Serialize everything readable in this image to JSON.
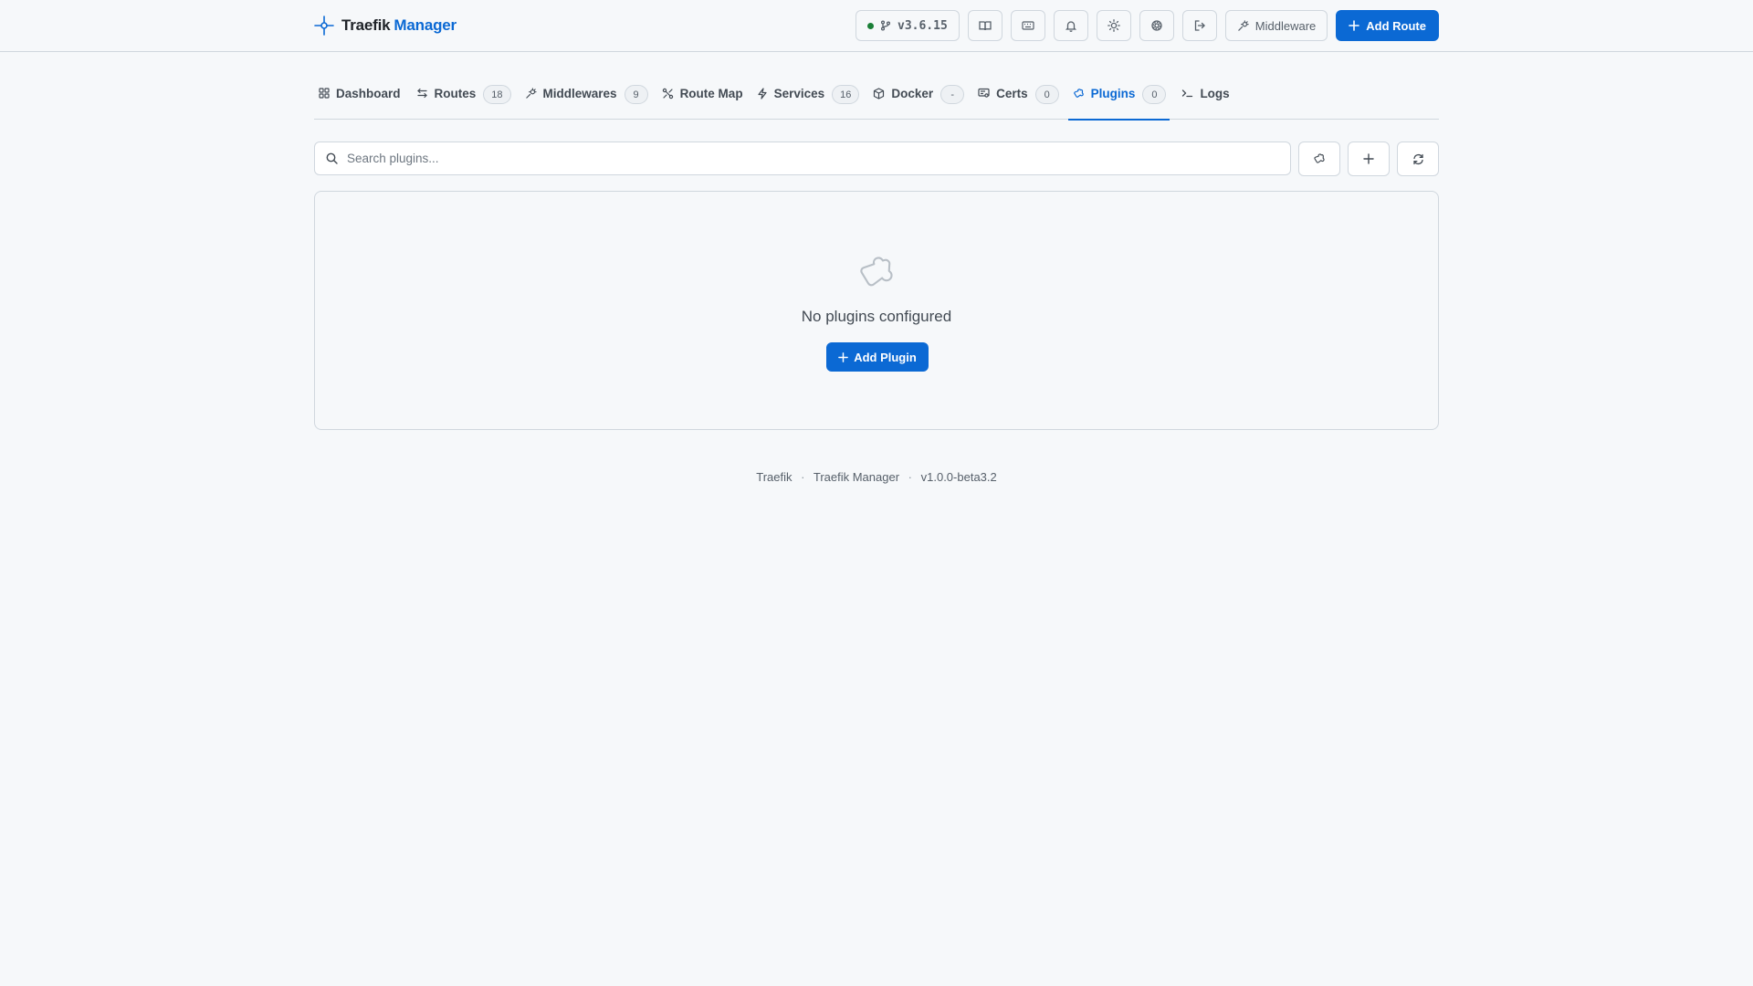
{
  "header": {
    "brand_first": "Traefik",
    "brand_second": "Manager",
    "version": "v3.6.15",
    "status_color": "#1a7f37",
    "icons": [
      "book-icon",
      "keyboard-icon",
      "bell-icon",
      "sun-icon",
      "settings-icon",
      "logout-icon"
    ],
    "middleware_label": "Middleware",
    "add_route_label": "Add Route"
  },
  "tabs": [
    {
      "label": "Dashboard",
      "icon": "grid-icon"
    },
    {
      "label": "Routes",
      "badge": "18",
      "icon": "arrows-icon"
    },
    {
      "label": "Middlewares",
      "badge": "9",
      "icon": "middleware-icon"
    },
    {
      "label": "Route Map",
      "icon": "route-map-icon"
    },
    {
      "label": "Services",
      "badge": "16",
      "icon": "bolt-icon"
    },
    {
      "label": "Docker",
      "badge": "-",
      "icon": "box-icon"
    },
    {
      "label": "Certs",
      "badge": "0",
      "icon": "cert-icon"
    },
    {
      "label": "Plugins",
      "badge": "0",
      "icon": "puzzle-icon",
      "active": true
    },
    {
      "label": "Logs",
      "icon": "terminal-icon"
    }
  ],
  "search": {
    "placeholder": "Search plugins..."
  },
  "empty": {
    "icon": "puzzle-icon",
    "title": "No plugins configured",
    "button_label": "Add Plugin"
  },
  "footer": {
    "items": [
      "Traefik",
      "Traefik Manager",
      "v1.0.0-beta3.2"
    ]
  },
  "colors": {
    "accent": "#0b69d4",
    "background": "#f6f8fa",
    "border": "#d0d7de"
  }
}
